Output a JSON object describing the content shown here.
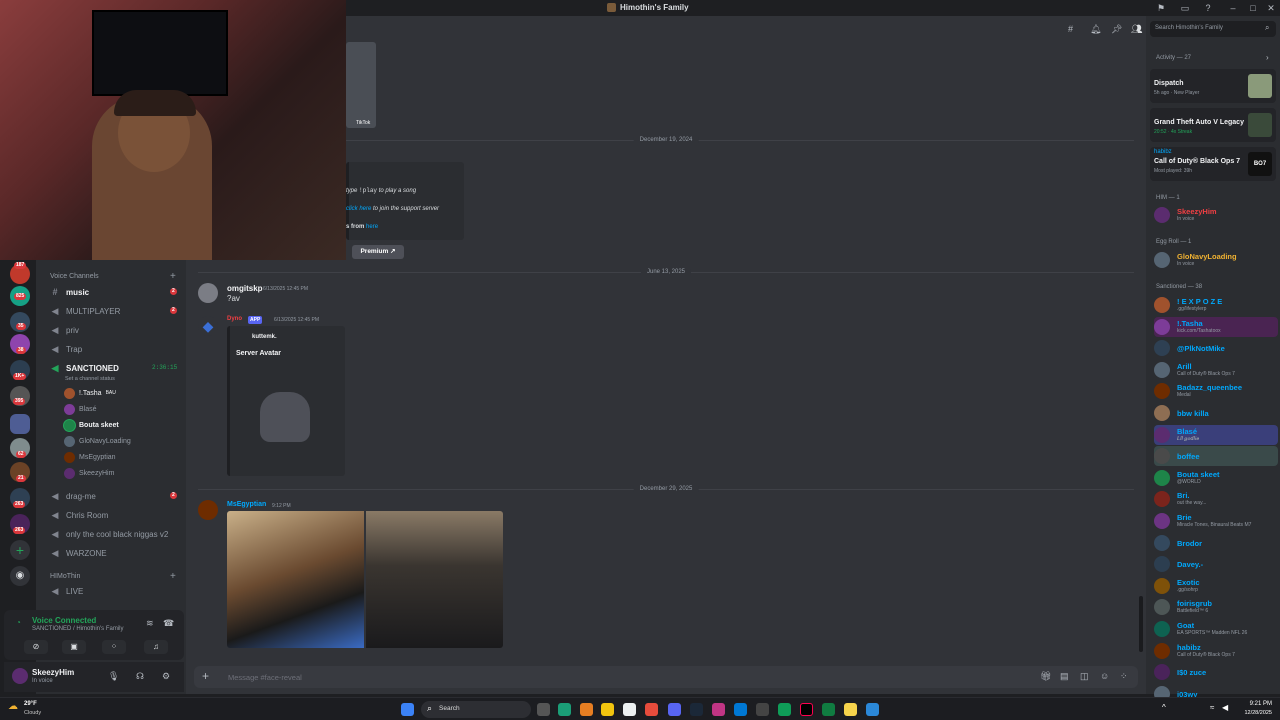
{
  "window": {
    "title": "Himothin's Family"
  },
  "search": {
    "placeholder": "Search Himothin's Family"
  },
  "rail": {
    "badges": [
      "187",
      "825",
      "35",
      "38",
      "1K+",
      "395",
      "62",
      "21",
      "263",
      "263"
    ]
  },
  "sidebar": {
    "voice_category": "Voice Channels",
    "channels": [
      {
        "name": "music",
        "badge": "2",
        "type": "text"
      },
      {
        "name": "MULTIPLAYER",
        "badge": "2",
        "type": "voice"
      },
      {
        "name": "priv",
        "type": "voice"
      },
      {
        "name": "Trap",
        "type": "voice"
      },
      {
        "name": "SANCTIONED",
        "timer": "2:36:15",
        "type": "voice",
        "status": "Set a channel status"
      }
    ],
    "voice_users": [
      {
        "name": "!.Tasha",
        "tag": "BAU"
      },
      {
        "name": "Blasé"
      },
      {
        "name": "Bouta skeet"
      },
      {
        "name": "GloNavyLoading"
      },
      {
        "name": "MsEgyptian"
      },
      {
        "name": "SkeezyHim"
      }
    ],
    "more_channels": [
      {
        "name": "drag-me",
        "badge": "2"
      },
      {
        "name": "Chris Room"
      },
      {
        "name": "only the cool black niggas v2"
      },
      {
        "name": "WARZONE"
      }
    ],
    "category2": "HIMoThin",
    "live_channel": "LIVE"
  },
  "voice_panel": {
    "status": "Voice Connected",
    "location": "SANCTIONED / Himothin's Family"
  },
  "user_panel": {
    "name": "SkeezyHim",
    "status": "In voice"
  },
  "chat": {
    "tiktok_label": "TikTok",
    "date1": "December 19, 2024",
    "embed_lines": {
      "l1": "type",
      "cmd": "!play",
      "l1b": "to play a song",
      "link": "click here",
      "l2b": "to join the support server",
      "l3": "s from",
      "l3link": "here"
    },
    "premium_label": "Premium",
    "date2": "June 13, 2025",
    "msg1": {
      "user": "omgitskp",
      "time": "6/13/2025 12:45 PM",
      "text": "?av"
    },
    "msg2": {
      "user": "Dyno",
      "app": "APP",
      "time": "6/13/2025 12:45 PM",
      "embed_user": "kuttemk.",
      "embed_title": "Server Avatar"
    },
    "date3": "December 29, 2025",
    "msg3": {
      "user": "MsEgyptian",
      "time": "9:12 PM"
    },
    "composer_placeholder": "Message #face-reveal"
  },
  "members": {
    "activity_header": "Activity — 27",
    "activities": [
      {
        "game": "Dispatch",
        "meta": "5h ago · New Player"
      },
      {
        "game": "Grand Theft Auto V Legacy",
        "meta": "20:52 · 4x Streak"
      },
      {
        "user": "habibz",
        "game": "Call of Duty® Black Ops 7",
        "meta": "Most played: 39h"
      }
    ],
    "him_header": "HIM — 1",
    "him": [
      {
        "name": "SkeezyHim",
        "status": "In voice",
        "color": "#f23f43"
      }
    ],
    "eggroll_header": "Egg Roll — 1",
    "eggroll": [
      {
        "name": "GloNavyLoading",
        "status": "In voice",
        "color": "#f0b232"
      }
    ],
    "sanctioned_header": "Sanctioned — 38",
    "sanctioned": [
      {
        "name": "! E X P O Z E",
        "status": ".gg/lifestylerp",
        "color": "#00a8fc"
      },
      {
        "name": "!.Tasha",
        "status": "kick.com/Tashatoox",
        "color": "#00a8fc"
      },
      {
        "name": "@PlkNotMike",
        "status": "",
        "color": "#00a8fc"
      },
      {
        "name": "Arill",
        "status": "Call of Duty® Black Ops 7",
        "color": "#00a8fc"
      },
      {
        "name": "Badazz_queenbee",
        "status": "Medal",
        "color": "#00a8fc"
      },
      {
        "name": "bbw killa",
        "status": "",
        "color": "#00a8fc"
      },
      {
        "name": "Blasé",
        "status": "𝑳𝒍𝒍 𝒈𝒐𝒅𝒍𝒊𝒆",
        "color": "#00a8fc"
      },
      {
        "name": "boffee",
        "status": "",
        "color": "#00a8fc"
      },
      {
        "name": "Bouta skeet",
        "status": "@WORLD",
        "color": "#00a8fc"
      },
      {
        "name": "Bri.",
        "status": "out the way...",
        "color": "#00a8fc"
      },
      {
        "name": "Brie",
        "status": "Miracle Tones, Binaural Beats M7",
        "color": "#00a8fc"
      },
      {
        "name": "Brodor",
        "status": "",
        "color": "#00a8fc"
      },
      {
        "name": "Davey.-",
        "status": "",
        "color": "#00a8fc"
      },
      {
        "name": "Exotic",
        "status": ".gg/sohrp",
        "color": "#00a8fc"
      },
      {
        "name": "foirisgrub",
        "status": "Battlefield™ 6",
        "color": "#00a8fc"
      },
      {
        "name": "Goat",
        "status": "EA SPORTS™ Madden NFL 26",
        "color": "#00a8fc"
      },
      {
        "name": "habibz",
        "status": "Call of Duty® Black Ops 7",
        "color": "#00a8fc"
      },
      {
        "name": "I$0 zuce",
        "status": "",
        "color": "#00a8fc"
      },
      {
        "name": "j03wy",
        "status": "",
        "color": "#00a8fc"
      }
    ]
  },
  "taskbar": {
    "weather_temp": "29°F",
    "weather_desc": "Cloudy",
    "search_label": "Search",
    "time": "9:21 PM",
    "date": "12/28/2025"
  }
}
